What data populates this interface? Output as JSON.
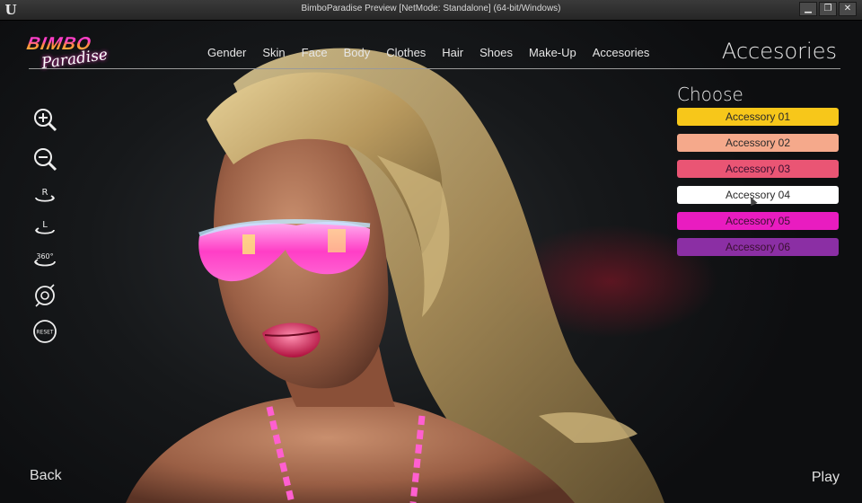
{
  "window": {
    "title": "BimboParadise Preview [NetMode: Standalone] (64-bit/Windows)",
    "controls": [
      "▁",
      "❐",
      "✕"
    ]
  },
  "logo": {
    "top": "BIMBO",
    "bottom": "Paradise"
  },
  "nav": {
    "items": [
      "Gender",
      "Skin",
      "Face",
      "Body",
      "Clothes",
      "Hair",
      "Shoes",
      "Make-Up",
      "Accesories"
    ]
  },
  "page_title": "Accesories",
  "choose_label": "Choose",
  "accessories": [
    {
      "label": "Accessory 01",
      "color": "#f7c71a"
    },
    {
      "label": "Accessory 02",
      "color": "#f5a98b"
    },
    {
      "label": "Accessory 03",
      "color": "#ea5574"
    },
    {
      "label": "Accessory 04",
      "color": "#ffffff"
    },
    {
      "label": "Accessory 05",
      "color": "#e91cc0"
    },
    {
      "label": "Accessory 06",
      "color": "#8b2fa4"
    }
  ],
  "tools": [
    {
      "name": "zoom-in-icon"
    },
    {
      "name": "zoom-out-icon"
    },
    {
      "name": "rotate-right-icon",
      "glyph": "R"
    },
    {
      "name": "rotate-left-icon",
      "glyph": "L"
    },
    {
      "name": "rotate-360-icon",
      "glyph": "360°"
    },
    {
      "name": "camera-icon"
    },
    {
      "name": "reset-icon",
      "glyph": "RESET"
    }
  ],
  "footer": {
    "back": "Back",
    "play": "Play"
  }
}
